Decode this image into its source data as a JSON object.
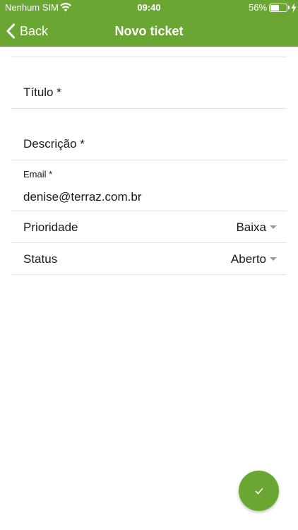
{
  "status_bar": {
    "carrier": "Nenhum SIM",
    "time": "09:40",
    "battery_percent_label": "56%",
    "battery_level": 0.56,
    "icons": [
      "wifi-icon",
      "battery-icon",
      "bolt-icon"
    ]
  },
  "nav": {
    "back_label": "Back",
    "title": "Novo ticket"
  },
  "form": {
    "title_placeholder": "Título *",
    "description_placeholder": "Descrição *",
    "email_label": "Email *",
    "email_value": "denise@terraz.com.br",
    "priority": {
      "label": "Prioridade",
      "value": "Baixa"
    },
    "status": {
      "label": "Status",
      "value": "Aberto"
    }
  },
  "fab": {
    "icon": "check-icon"
  },
  "colors": {
    "accent": "#6aa632",
    "divider": "#e2e2e2",
    "text": "#1a1a1a",
    "caret": "#9a9a9a"
  }
}
